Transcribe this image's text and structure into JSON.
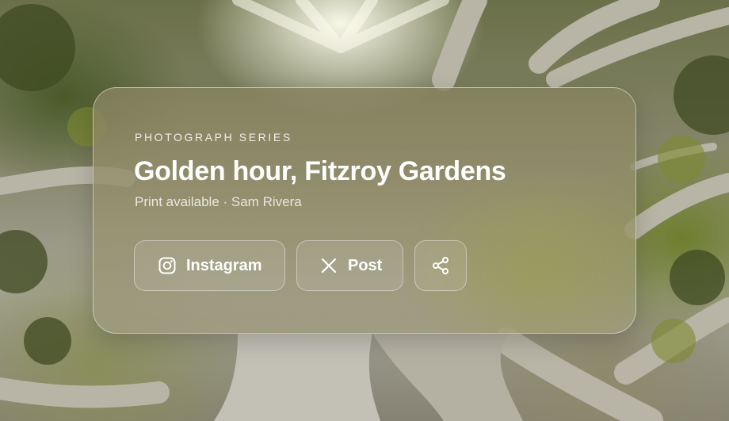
{
  "card": {
    "eyebrow": "PHOTOGRAPH SERIES",
    "title": "Golden hour, Fitzroy Gardens",
    "subtitle": "Print available · Sam Rivera"
  },
  "actions": [
    {
      "label": "Instagram",
      "icon": "instagram-icon"
    },
    {
      "label": "Post",
      "icon": "x-icon"
    },
    {
      "label": "",
      "icon": "share-icon"
    }
  ]
}
